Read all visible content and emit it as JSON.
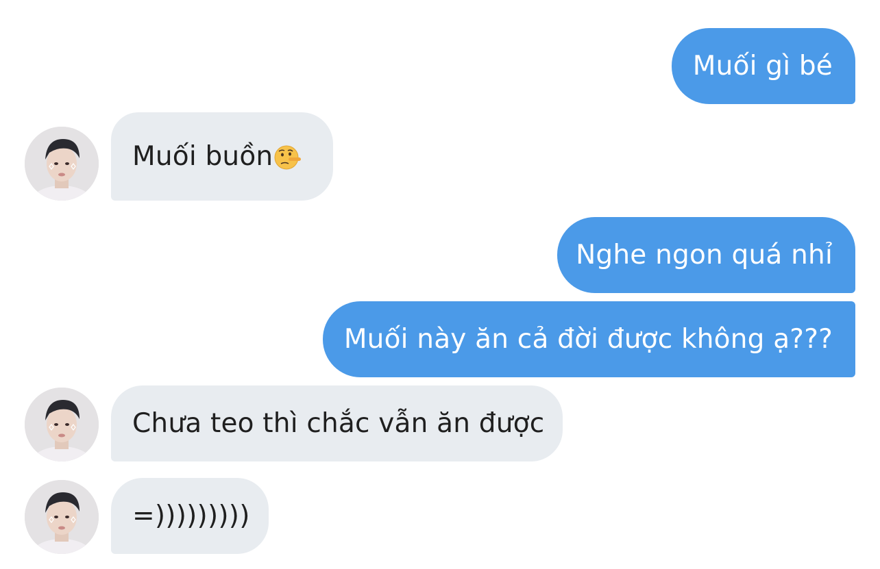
{
  "conversation": {
    "messages": [
      {
        "id": "m1",
        "direction": "outgoing",
        "text": "Muối gì bé"
      },
      {
        "id": "m2",
        "direction": "incoming",
        "text": "Muối buồn",
        "emoji": "lying-face-emoji"
      },
      {
        "id": "m3",
        "direction": "outgoing",
        "text": "Nghe ngon quá nhỉ"
      },
      {
        "id": "m4",
        "direction": "outgoing",
        "text": "Muối này ăn cả đời được không ạ???"
      },
      {
        "id": "m5",
        "direction": "incoming",
        "text": "Chưa teo thì chắc vẫn ăn được"
      },
      {
        "id": "m6",
        "direction": "incoming",
        "text": "=)))))))))"
      }
    ]
  },
  "colors": {
    "outgoing_bubble": "#4b9ae8",
    "incoming_bubble": "#e8ecf0",
    "outgoing_text": "#ffffff",
    "incoming_text": "#1f1f1f",
    "background": "#ffffff"
  },
  "icons": {
    "avatar": "contact-avatar-photo",
    "emoji": "lying-face-emoji"
  }
}
